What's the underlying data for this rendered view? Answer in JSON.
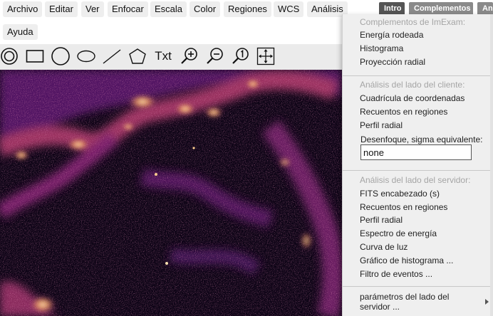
{
  "menu": {
    "file": "Archivo",
    "edit": "Editar",
    "view": "Ver",
    "frame": "Enfocar",
    "scale": "Escala",
    "color": "Color",
    "regions": "Regiones",
    "wcs": "WCS",
    "analysis": "Análisis",
    "help": "Ayuda"
  },
  "tabs": {
    "intro": "Intro",
    "plugins": "Complementos",
    "analysis_truncated": "An"
  },
  "toolbar": {
    "text_tool": "Txt",
    "icons": [
      "annulus-icon",
      "box-icon",
      "circle-icon",
      "ellipse-icon",
      "line-icon",
      "polygon-icon",
      "text-icon",
      "zoom-in-icon",
      "zoom-out-icon",
      "zoom-1-icon",
      "pan-icon"
    ]
  },
  "dropdown": {
    "imexam_header": "Complementos de ImExam:",
    "imexam_items": [
      "Energía rodeada",
      "Histograma",
      "Proyección radial"
    ],
    "client_header": "Análisis del lado del cliente:",
    "client_items": [
      "Cuadrícula de coordenadas",
      "Recuentos en regiones",
      "Perfil radial"
    ],
    "blur_label": "Desenfoque, sigma equivalente:",
    "blur_value": "none",
    "server_header": "Análisis del lado del servidor:",
    "server_items": [
      "FITS encabezado (s)",
      "Recuentos en regiones",
      "Perfil radial",
      "Espectro de energía",
      "Curva de luz",
      "Gráfico de histograma ...",
      "Filtro de eventos ..."
    ],
    "server_params_line1": "parámetros del lado del",
    "server_params_line2": "servidor ..."
  },
  "colors": {
    "image_background": "#0c0315",
    "colormap": [
      "#2b0a4a",
      "#6a1a78",
      "#b0306c",
      "#e4614a",
      "#f7b26a",
      "#fde8b0"
    ]
  }
}
